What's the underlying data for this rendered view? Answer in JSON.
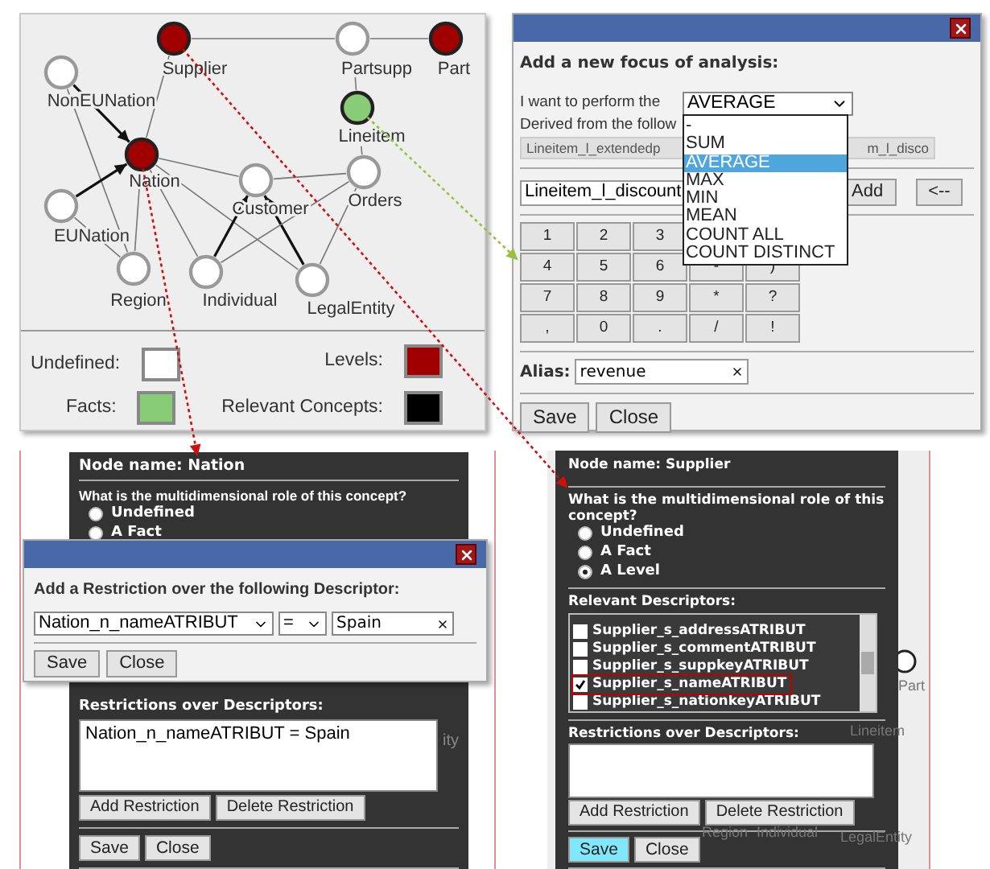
{
  "graph_panel": {
    "nodes": [
      {
        "label": "Supplier",
        "kind": "level"
      },
      {
        "label": "Partsupp",
        "kind": "undefined"
      },
      {
        "label": "Part",
        "kind": "level"
      },
      {
        "label": "NonEUNation",
        "kind": "undefined"
      },
      {
        "label": "Lineitem",
        "kind": "fact"
      },
      {
        "label": "Nation",
        "kind": "level"
      },
      {
        "label": "Customer",
        "kind": "undefined"
      },
      {
        "label": "Orders",
        "kind": "undefined"
      },
      {
        "label": "EUNation",
        "kind": "undefined"
      },
      {
        "label": "Region",
        "kind": "undefined"
      },
      {
        "label": "Individual",
        "kind": "undefined"
      },
      {
        "label": "LegalEntity",
        "kind": "undefined"
      }
    ],
    "legend": [
      {
        "label": "Undefined:",
        "kind": "undefined"
      },
      {
        "label": "Levels:",
        "kind": "level"
      },
      {
        "label": "Facts:",
        "kind": "fact"
      },
      {
        "label": "Relevant Concepts:",
        "kind": "relevant"
      }
    ]
  },
  "focus_dialog": {
    "heading": "Add a new focus of analysis:",
    "perform_label": "I want to perform the",
    "function_select": "AVERAGE",
    "derived_label": "Derived from the follow",
    "derived_left": "Lineitem_l_extendedp",
    "derived_right": "m_l_disco",
    "descriptor_select": "Lineitem_l_discount",
    "add_button": "Add",
    "back_button": "<--",
    "keypad": [
      [
        "1",
        "2",
        "3"
      ],
      [
        "4",
        "5",
        "6",
        "-",
        ")"
      ],
      [
        "7",
        "8",
        "9",
        "*",
        "?"
      ],
      [
        ",",
        "0",
        ".",
        "/",
        "!"
      ]
    ],
    "alias_label": "Alias:",
    "alias_value": "revenue",
    "buttons": [
      "Save",
      "Close"
    ],
    "dropdown": [
      {
        "label": "-",
        "selected": false
      },
      {
        "label": "SUM",
        "selected": false
      },
      {
        "label": "AVERAGE",
        "selected": true
      },
      {
        "label": "MAX",
        "selected": false
      },
      {
        "label": "MIN",
        "selected": false
      },
      {
        "label": "MEAN",
        "selected": false
      },
      {
        "label": "COUNT ALL",
        "selected": false
      },
      {
        "label": "COUNT DISTINCT",
        "selected": false
      }
    ]
  },
  "nation_panel": {
    "node_name": "Node name: Nation",
    "question": "What is the multidimensional role of this concept?",
    "roles": [
      {
        "label": "Undefined",
        "selected": false
      },
      {
        "label": "A Fact",
        "selected": false
      }
    ],
    "restrictions_label": "Restrictions over Descriptors:",
    "restrictions": [
      "Nation_n_nameATRIBUT = Spain"
    ],
    "list_buttons": [
      "Add Restriction",
      "Delete Restriction"
    ],
    "buttons": [
      {
        "label": "Save",
        "focused": false
      },
      {
        "label": "Close",
        "focused": false
      }
    ],
    "background_labels": [
      "ity"
    ]
  },
  "restriction_dialog": {
    "heading": "Add a Restriction over the following Descriptor:",
    "descriptor_select": "Nation_n_nameATRIBUT",
    "operator_select": "=",
    "value": "Spain",
    "buttons": [
      "Save",
      "Close"
    ]
  },
  "supplier_panel": {
    "node_name": "Node name: Supplier",
    "question": "What is the multidimensional role of this concept?",
    "roles": [
      {
        "label": "Undefined",
        "selected": false
      },
      {
        "label": "A Fact",
        "selected": false
      },
      {
        "label": "A Level",
        "selected": true
      }
    ],
    "descriptors_label": "Relevant Descriptors:",
    "descriptors": [
      {
        "label": "Supplier_s_addressATRIBUT",
        "checked": false
      },
      {
        "label": "Supplier_s_commentATRIBUT",
        "checked": false
      },
      {
        "label": "Supplier_s_suppkeyATRIBUT",
        "checked": false
      },
      {
        "label": "Supplier_s_nameATRIBUT",
        "checked": true
      },
      {
        "label": "Supplier_s_nationkeyATRIBUT",
        "checked": false
      }
    ],
    "restrictions_label": "Restrictions over Descriptors:",
    "list_buttons": [
      "Add Restriction",
      "Delete Restriction"
    ],
    "buttons": [
      {
        "label": "Save",
        "focused": true
      },
      {
        "label": "Close",
        "focused": false
      }
    ],
    "background_labels": [
      "Part",
      "Lineitem",
      "Region",
      "Individual",
      "LegalEntity"
    ]
  }
}
